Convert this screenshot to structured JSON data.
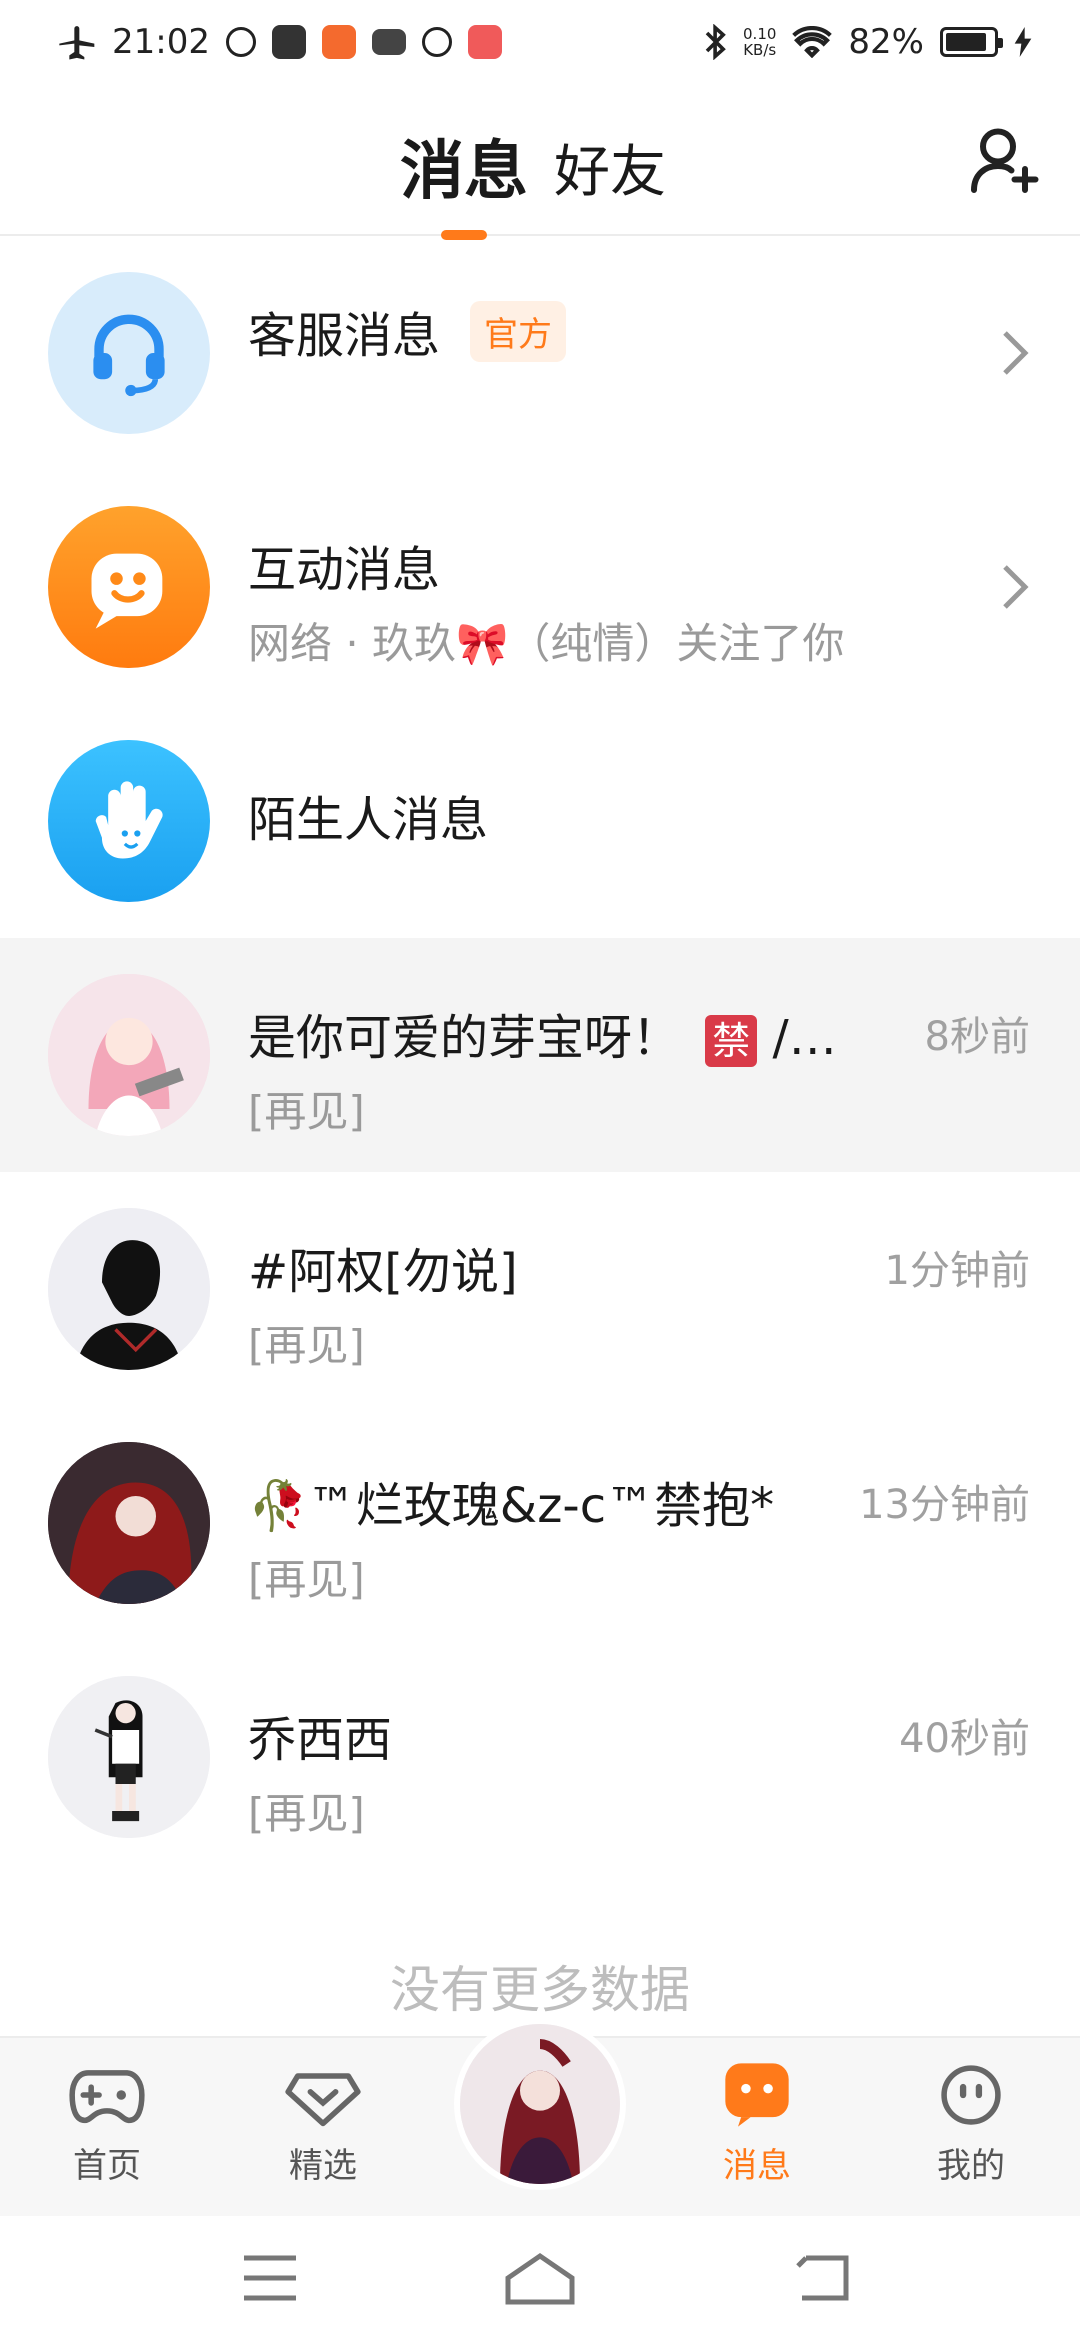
{
  "status_bar": {
    "time": "21:02",
    "net_speed_value": "0.10",
    "net_speed_unit": "KB/s",
    "battery": "82%"
  },
  "header": {
    "tab_messages": "消息",
    "tab_friends": "好友"
  },
  "system_rows": [
    {
      "title": "客服消息",
      "badge": "官方",
      "subtitle": ""
    },
    {
      "title": "互动消息",
      "subtitle": "网络 · 玖玖🎀（纯情）关注了你"
    },
    {
      "title": "陌生人消息"
    }
  ],
  "chats": [
    {
      "name": "是你可爱的芽宝呀！",
      "name_suffix": "/…",
      "ban": "禁",
      "preview": "[再见]",
      "time": "8秒前"
    },
    {
      "name": "#阿权[勿说]",
      "preview": "[再见]",
      "time": "1分钟前"
    },
    {
      "name": "🥀™烂玫瑰&z-c™禁抱*",
      "preview": "[再见]",
      "time": "13分钟前"
    },
    {
      "name": "乔西西",
      "preview": "[再见]",
      "time": "40秒前"
    }
  ],
  "footer": {
    "no_more": "没有更多数据"
  },
  "bottom_nav": {
    "home": "首页",
    "featured": "精选",
    "messages": "消息",
    "mine": "我的"
  },
  "colors": {
    "accent": "#ff7a1a",
    "muted": "#9a9a9a"
  }
}
